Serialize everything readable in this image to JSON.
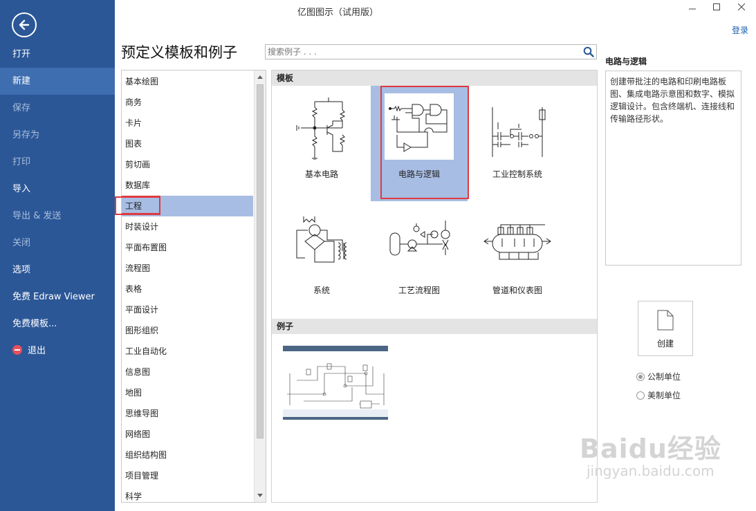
{
  "window": {
    "title": "亿图图示（试用版）",
    "login": "登录"
  },
  "sidebar": {
    "items": [
      {
        "label": "打开",
        "state": "normal"
      },
      {
        "label": "新建",
        "state": "active"
      },
      {
        "label": "保存",
        "state": "disabled"
      },
      {
        "label": "另存为",
        "state": "disabled"
      },
      {
        "label": "打印",
        "state": "disabled"
      },
      {
        "label": "导入",
        "state": "normal"
      },
      {
        "label": "导出 & 发送",
        "state": "disabled"
      },
      {
        "label": "关闭",
        "state": "disabled"
      },
      {
        "label": "选项",
        "state": "normal"
      },
      {
        "label": "免费 Edraw Viewer",
        "state": "normal"
      },
      {
        "label": "免费模板...",
        "state": "normal"
      },
      {
        "label": "退出",
        "state": "normal"
      }
    ]
  },
  "page": {
    "title": "预定义模板和例子"
  },
  "search": {
    "placeholder": "搜索例子 . . ."
  },
  "categories": {
    "selected": "工程",
    "items": [
      "基本绘图",
      "商务",
      "卡片",
      "图表",
      "剪切画",
      "数据库",
      "工程",
      "时装设计",
      "平面布置图",
      "流程图",
      "表格",
      "平面设计",
      "图形组织",
      "工业自动化",
      "信息图",
      "地图",
      "思维导图",
      "网络图",
      "组织结构图",
      "项目管理",
      "科学"
    ]
  },
  "templates": {
    "section_title": "模板",
    "selected": "电路与逻辑",
    "items": [
      {
        "label": "基本电路"
      },
      {
        "label": "电路与逻辑"
      },
      {
        "label": "工业控制系统"
      },
      {
        "label": "系统"
      },
      {
        "label": "工艺流程图"
      },
      {
        "label": "管道和仪表图"
      }
    ]
  },
  "examples": {
    "section_title": "例子"
  },
  "details": {
    "title": "电路与逻辑",
    "description": "创建带批注的电路和印刷电路板图、集成电路示意图和数字、模拟逻辑设计。包含终端机、连接线和传输路径形状。"
  },
  "create": {
    "label": "创建"
  },
  "units": {
    "selected": "公制单位",
    "options": [
      "公制单位",
      "美制单位"
    ]
  },
  "watermark": {
    "main": "Baidu经验",
    "sub": "jingyan.baidu.com"
  },
  "colors": {
    "sidebar": "#2b5797",
    "sidebar_active": "#3e6db0",
    "selection": "#a8bde3",
    "highlight_box": "#e0393e",
    "link": "#1a5fb4"
  }
}
